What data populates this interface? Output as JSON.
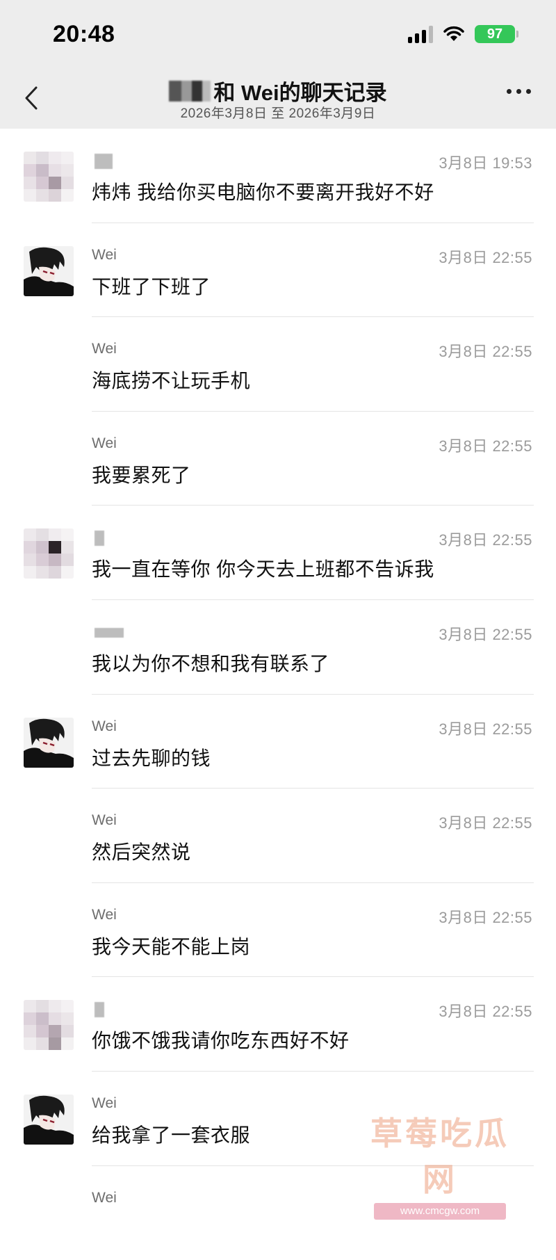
{
  "status_bar": {
    "time": "20:48",
    "battery": "97",
    "icons": [
      "signal-icon",
      "wifi-icon",
      "battery-icon"
    ],
    "battery_color": "#34c759"
  },
  "header": {
    "title_suffix": "和 Wei的聊天记录",
    "subtitle": "2026年3月8日 至 2026年3月9日",
    "back_icon": "chevron-left-icon",
    "more_icon": "more-dots-icon"
  },
  "messages": [
    {
      "sender": "",
      "avatar": "mosaic",
      "time": "3月8日 19:53",
      "text": "炜炜 我给你买电脑你不要离开我好不好"
    },
    {
      "sender": "Wei",
      "avatar": "anime",
      "time": "3月8日 22:55",
      "text": "下班了下班了"
    },
    {
      "sender": "Wei",
      "avatar": "",
      "time": "3月8日 22:55",
      "text": "海底捞不让玩手机"
    },
    {
      "sender": "Wei",
      "avatar": "",
      "time": "3月8日 22:55",
      "text": "我要累死了"
    },
    {
      "sender": "",
      "avatar": "mosaic",
      "time": "3月8日 22:55",
      "text": "我一直在等你 你今天去上班都不告诉我"
    },
    {
      "sender": "",
      "avatar": "",
      "time": "3月8日 22:55",
      "text": "我以为你不想和我有联系了"
    },
    {
      "sender": "Wei",
      "avatar": "anime",
      "time": "3月8日 22:55",
      "text": "过去先聊的钱"
    },
    {
      "sender": "Wei",
      "avatar": "",
      "time": "3月8日 22:55",
      "text": "然后突然说"
    },
    {
      "sender": "Wei",
      "avatar": "",
      "time": "3月8日 22:55",
      "text": "我今天能不能上岗"
    },
    {
      "sender": "",
      "avatar": "mosaic",
      "time": "3月8日 22:55",
      "text": "你饿不饿我请你吃东西好不好"
    },
    {
      "sender": "Wei",
      "avatar": "anime",
      "time": "",
      "text": "给我拿了一套衣服"
    },
    {
      "sender": "Wei",
      "avatar": "",
      "time": "",
      "text": ""
    }
  ],
  "watermark": {
    "title": "草莓吃瓜网",
    "url": "www.cmcgw.com"
  }
}
